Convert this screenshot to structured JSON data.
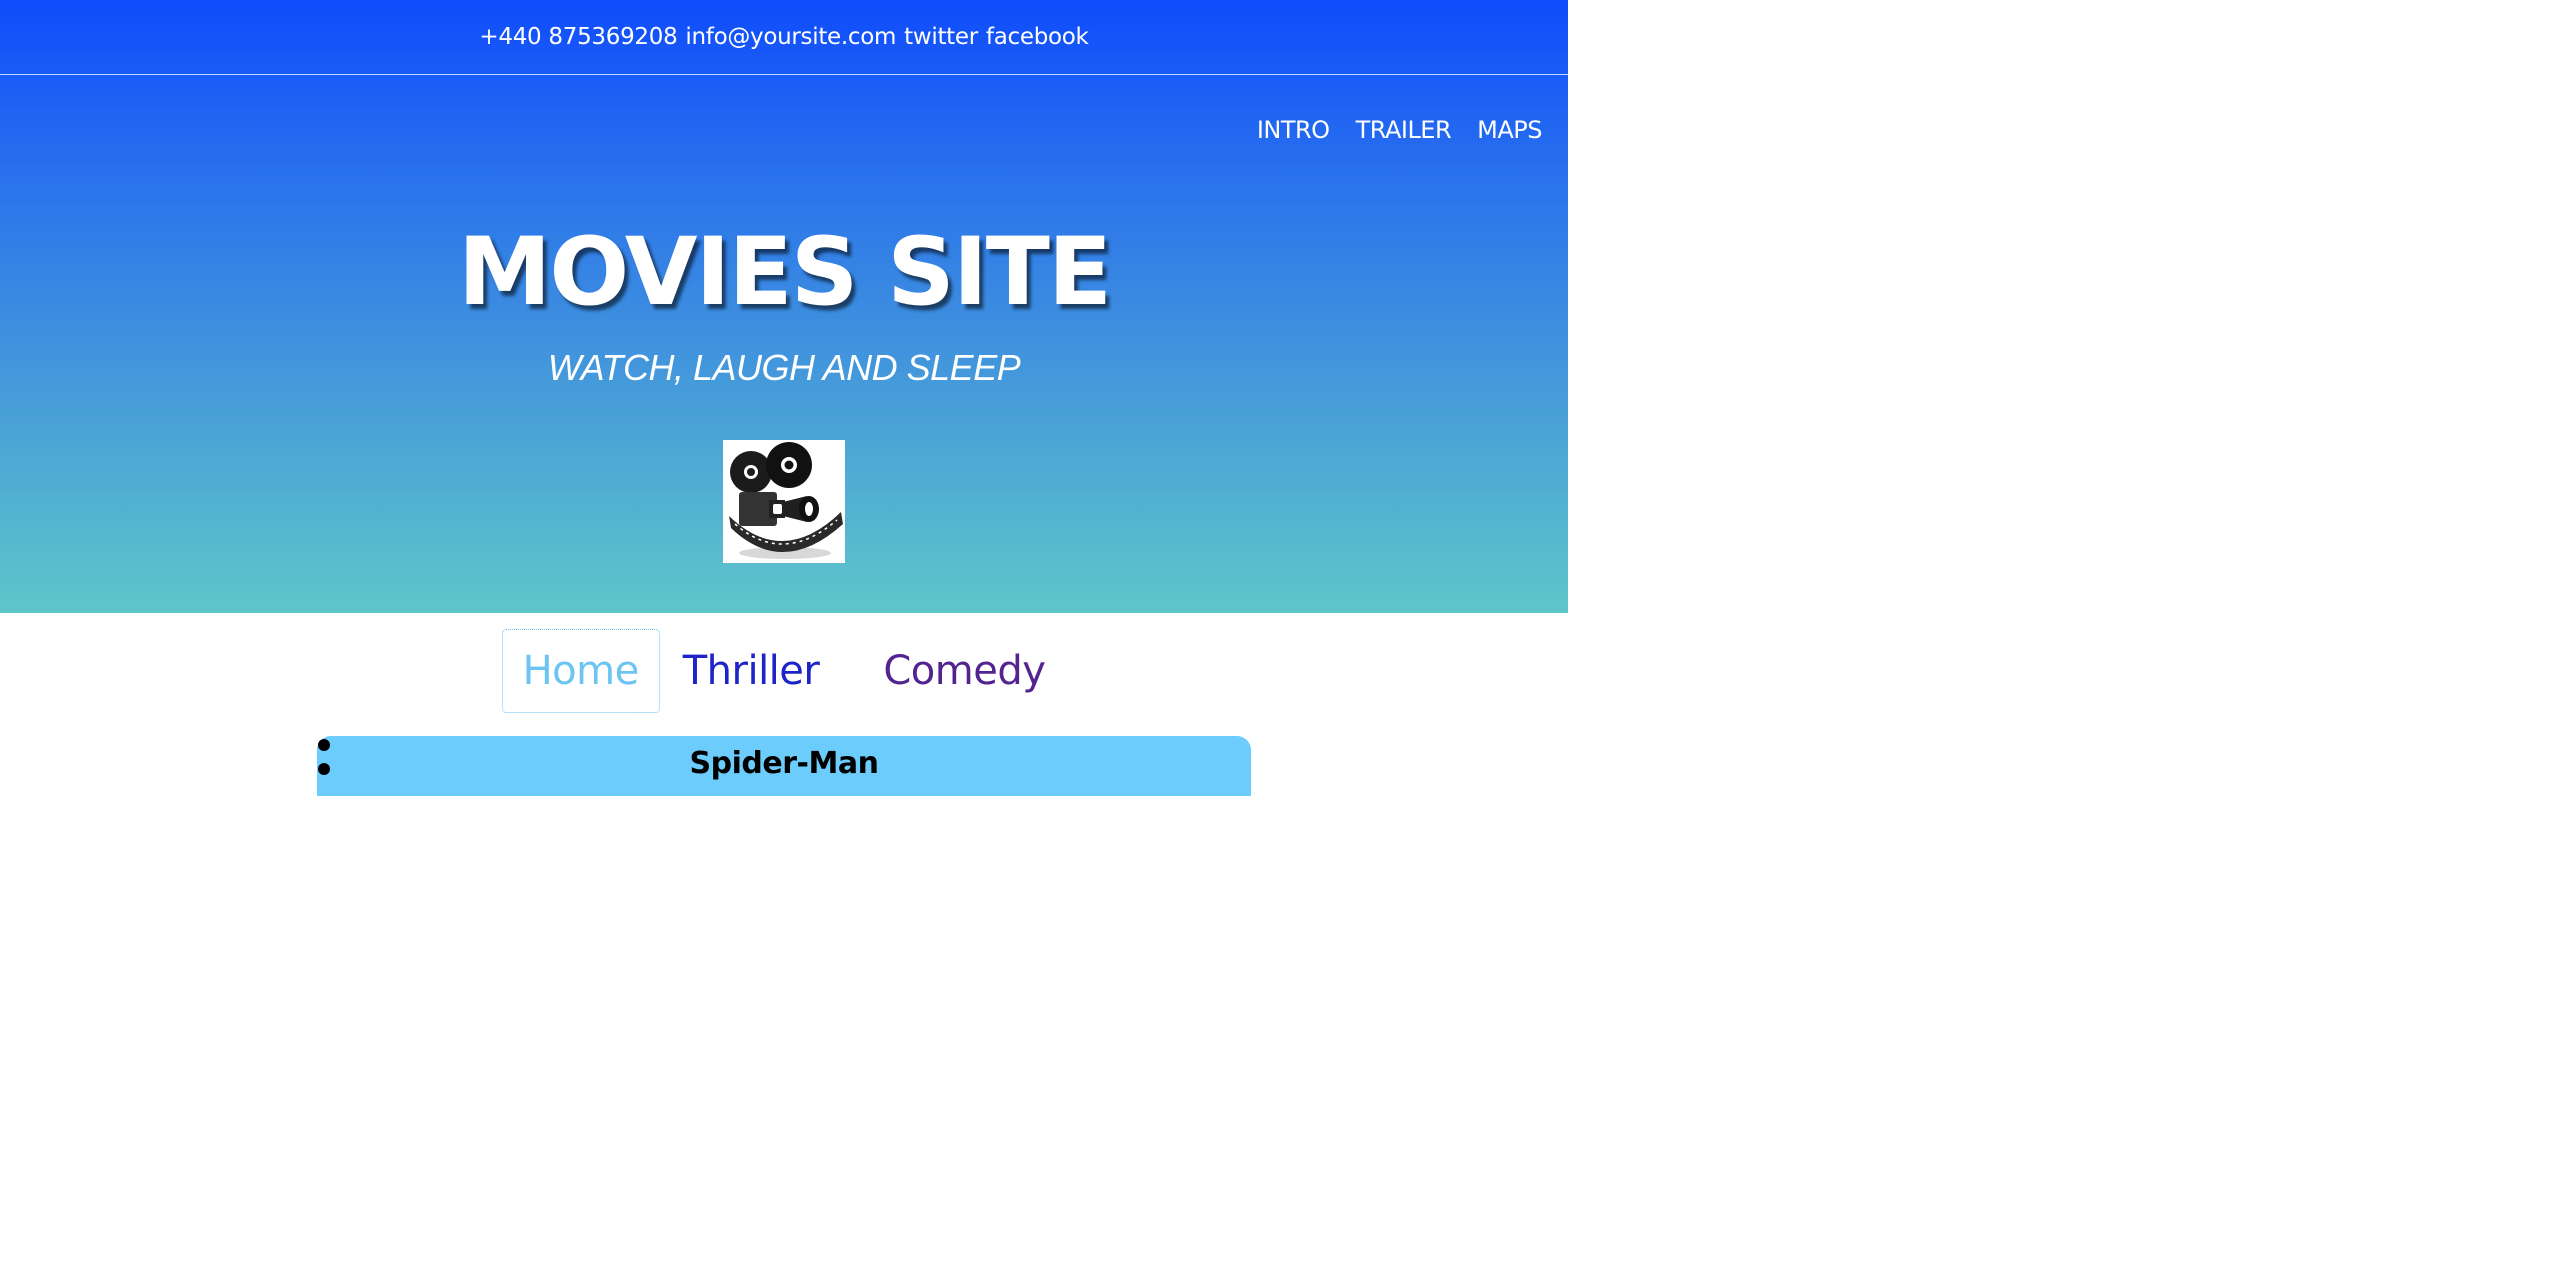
{
  "topbar": {
    "phone": "+440 875369208",
    "email": "info@yoursite.com",
    "twitter": "twitter",
    "facebook": "facebook"
  },
  "nav": {
    "items": [
      "INTRO",
      "TRAILER",
      "MAPS"
    ]
  },
  "hero": {
    "title": "MOVIES SITE",
    "tagline": "WATCH, LAUGH AND SLEEP",
    "logo_icon": "film-camera-icon"
  },
  "tabs": {
    "items": [
      "Home",
      "Thriller",
      "Comedy"
    ],
    "active": "Home"
  },
  "movies": [
    {
      "title": "Spider-Man"
    }
  ],
  "colors": {
    "gradient_top": "#0f4cfc",
    "gradient_bottom": "#5ec6ca",
    "tab_active": "#6cc4f2",
    "tab_thriller": "#1d25c9",
    "tab_comedy": "#53248f",
    "card_bg": "#6ccdfc"
  }
}
